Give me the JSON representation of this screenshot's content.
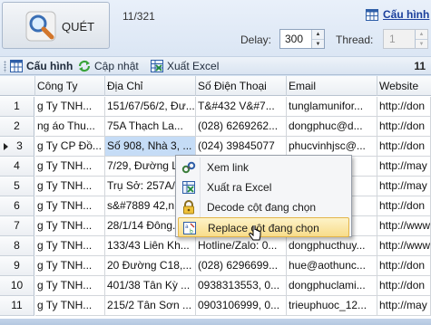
{
  "top": {
    "scan_label": "QUÉT",
    "counter": "11/321",
    "config_link": "Cấu hình",
    "delay_label": "Delay:",
    "delay_value": "300",
    "thread_label": "Thread:",
    "thread_value": "1"
  },
  "toolbar": {
    "config": "Cấu hình",
    "update": "Cập nhật",
    "export": "Xuất Excel",
    "count": "11"
  },
  "table": {
    "columns": [
      "Công Ty",
      "Địa Chỉ",
      "Số Điện Thoại",
      "Email",
      "Website"
    ],
    "rows": [
      {
        "n": "1",
        "company": "g Ty TNH...",
        "address": "151/67/56/2, Đư...",
        "phone": "T&#432 V&#7...",
        "email": "tunglamunifor...",
        "website": "http://don"
      },
      {
        "n": "2",
        "company": "ng áo Thu...",
        "address": "75A Thạch La...",
        "phone": "(028) 6269262...",
        "email": "dongphuc@d...",
        "website": "http://don"
      },
      {
        "n": "3",
        "company": "g Ty CP Đồ...",
        "address": "Số 908, Nhà 3, ...",
        "phone": "(024) 39845077",
        "email": "phucvinhjsc@...",
        "website": "http://don"
      },
      {
        "n": "4",
        "company": "g Ty TNH...",
        "address": "7/29, Đường L...",
        "phone": "",
        "email": "",
        "website": "http://may"
      },
      {
        "n": "5",
        "company": "g Ty TNH...",
        "address": "Trụ Sở: 257A/...",
        "phone": "",
        "email": "",
        "website": "http://may"
      },
      {
        "n": "6",
        "company": "g Ty TNH...",
        "address": "s&#7889 42,n...",
        "phone": "",
        "email": "",
        "website": "http://don"
      },
      {
        "n": "7",
        "company": "g Ty TNH...",
        "address": "28/1/14 Đông...",
        "phone": "",
        "email": "",
        "website": "http://www"
      },
      {
        "n": "8",
        "company": "g Ty TNH...",
        "address": "133/43 Liên Kh...",
        "phone": "Hotline/Zalo: 0...",
        "email": "dongphucthuy...",
        "website": "http://www"
      },
      {
        "n": "9",
        "company": "g Ty TNH...",
        "address": "20 Đường C18,...",
        "phone": "(028) 6296699...",
        "email": "hue@aothunc...",
        "website": "http://don"
      },
      {
        "n": "10",
        "company": "g Ty TNH...",
        "address": "401/38 Tân Kỳ ...",
        "phone": "0938313553, 0...",
        "email": "dongphuclami...",
        "website": "http://don"
      },
      {
        "n": "11",
        "company": "g Ty TNH...",
        "address": "215/2 Tân Sơn ...",
        "phone": "0903106999, 0...",
        "email": "trieuphuoc_12...",
        "website": "http://may"
      }
    ]
  },
  "context_menu": {
    "items": [
      {
        "label": "Xem link",
        "icon": "link-icon"
      },
      {
        "label": "Xuất ra Excel",
        "icon": "excel-icon"
      },
      {
        "label": "Decode cột đang chọn",
        "icon": "decode-lock-icon"
      },
      {
        "label": "Replace cột đang chọn",
        "icon": "replace-icon"
      }
    ]
  }
}
